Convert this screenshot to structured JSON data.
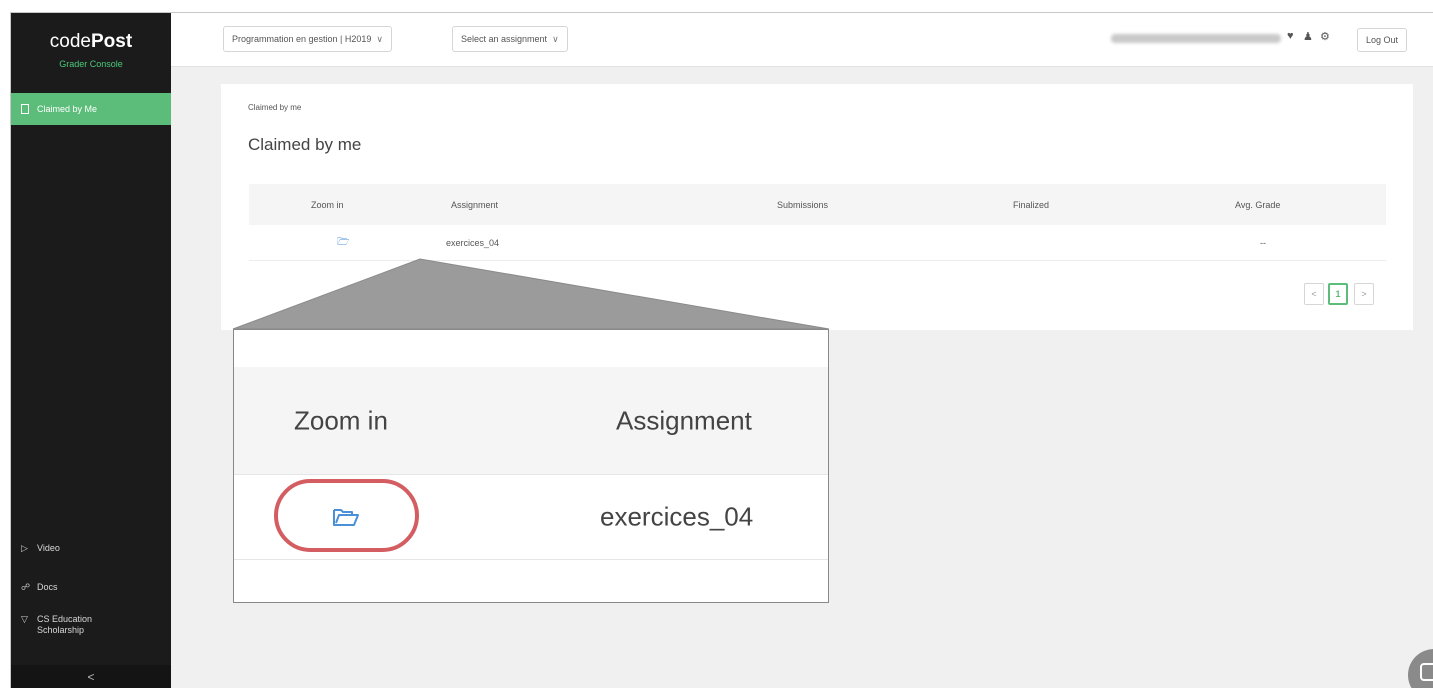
{
  "sidebar": {
    "logo_prefix": "code",
    "logo_bold": "Post",
    "subtitle": "Grader Console",
    "active_item": "Claimed by Me",
    "links": [
      {
        "icon": "video-icon",
        "label": "Video"
      },
      {
        "icon": "docs-icon",
        "label": "Docs"
      },
      {
        "icon": "trophy-icon",
        "label": "CS Education",
        "label2": "Scholarship"
      }
    ],
    "collapse_glyph": "<"
  },
  "header": {
    "course_select": "Programmation en gestion | H2019",
    "assignment_select": "Select an assignment",
    "logout_label": "Log Out"
  },
  "card": {
    "breadcrumb": "Claimed by me",
    "title": "Claimed by me",
    "columns": [
      "Zoom in",
      "Assignment",
      "Submissions",
      "Finalized",
      "Avg. Grade"
    ],
    "rows": [
      {
        "assignment": "exercices_04",
        "submissions": "",
        "finalized": "",
        "avg_grade": "--"
      }
    ],
    "pagination": {
      "prev": "<",
      "current": "1",
      "next": ">"
    }
  },
  "zoom": {
    "col_zoom": "Zoom in",
    "col_assignment": "Assignment",
    "assignment_value": "exercices_04"
  },
  "colors": {
    "accent_green": "#5bbd79",
    "sidebar_bg": "#1b1b1b",
    "highlight_red": "#d35d60",
    "folder_blue": "#4a90d9"
  }
}
